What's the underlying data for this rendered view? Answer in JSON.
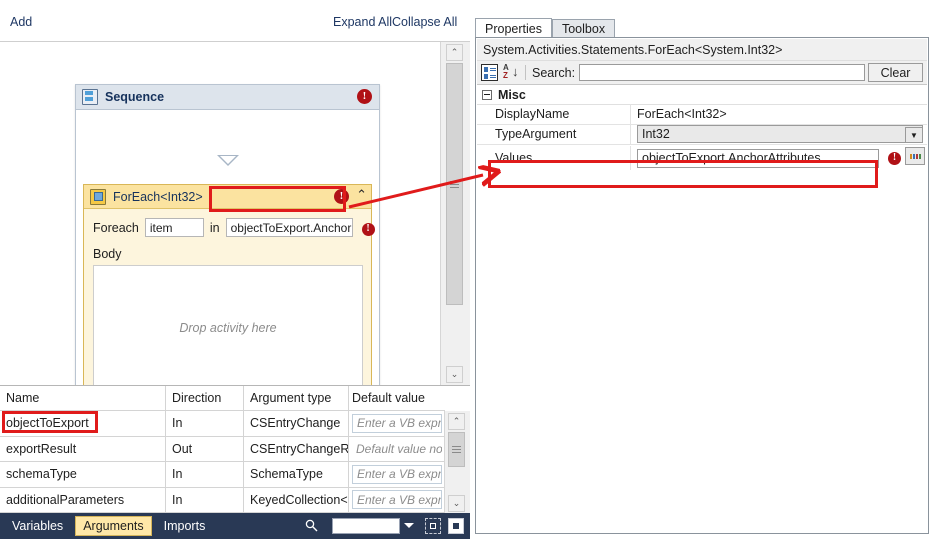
{
  "designer": {
    "add_label": "Add",
    "expand_all_label": "Expand All",
    "collapse_all_label": "Collapse All",
    "sequence": {
      "title": "Sequence",
      "icon": "sequence-icon",
      "error_glyph": "!"
    },
    "foreach": {
      "title": "ForEach<Int32>",
      "icon": "foreach-icon",
      "error_glyph": "!",
      "collapse_glyph": "⌃",
      "label": "Foreach",
      "variable": "item",
      "in_label": "in",
      "expression": "objectToExport.Anchor",
      "expression_error_glyph": "!",
      "body_label": "Body",
      "drop_hint": "Drop activity here"
    },
    "scrollbar": {
      "up_glyph": "⌃",
      "down_glyph": "⌄"
    }
  },
  "arguments_grid": {
    "columns": [
      "Name",
      "Direction",
      "Argument type",
      "Default value"
    ],
    "rows": [
      {
        "name": "objectToExport",
        "direction": "In",
        "type": "CSEntryChange",
        "default": "Enter a VB express",
        "default_boxed": true
      },
      {
        "name": "exportResult",
        "direction": "Out",
        "type": "CSEntryChangeReş",
        "default": "Default value not su",
        "default_boxed": false
      },
      {
        "name": "schemaType",
        "direction": "In",
        "type": "SchemaType",
        "default": "Enter a VB express",
        "default_boxed": true
      },
      {
        "name": "additionalParameters",
        "direction": "In",
        "type": "KeyedCollection<S",
        "default": "Enter a VB express",
        "default_boxed": true
      }
    ],
    "scrollbar": {
      "up_glyph": "⌃",
      "down_glyph": "⌄"
    }
  },
  "status_bar": {
    "tabs": [
      {
        "label": "Variables",
        "active": false
      },
      {
        "label": "Arguments",
        "active": true
      },
      {
        "label": "Imports",
        "active": false
      }
    ],
    "search_icon": "search-icon",
    "zoom_value": "",
    "zoom_caret": "caret-down-icon",
    "fit_icon": "fit-to-screen-icon",
    "reset_icon": "reset-zoom-icon"
  },
  "properties": {
    "tabs": [
      {
        "label": "Properties",
        "active": true
      },
      {
        "label": "Toolbox",
        "active": false
      }
    ],
    "type_name": "System.Activities.Statements.ForEach<System.Int32>",
    "toolbar": {
      "categorized_icon": "categorized-view-icon",
      "sort_icon": "sort-alphabetical-icon",
      "search_label": "Search:",
      "search_value": "",
      "clear_label": "Clear"
    },
    "group": {
      "label": "Misc",
      "toggle_icon": "collapse-group-icon"
    },
    "rows": [
      {
        "name": "DisplayName",
        "value": "ForEach<Int32>",
        "kind": "text"
      },
      {
        "name": "TypeArgument",
        "value": "Int32",
        "kind": "combo"
      },
      {
        "name": "Values",
        "value": "objectToExport.AnchorAttributes",
        "kind": "editor",
        "error_glyph": "!",
        "ellipsis_label": "..."
      }
    ]
  },
  "annotations": {
    "highlight_color": "#e01b1b",
    "arrow": "points from ForEach expression box to Values property row"
  }
}
